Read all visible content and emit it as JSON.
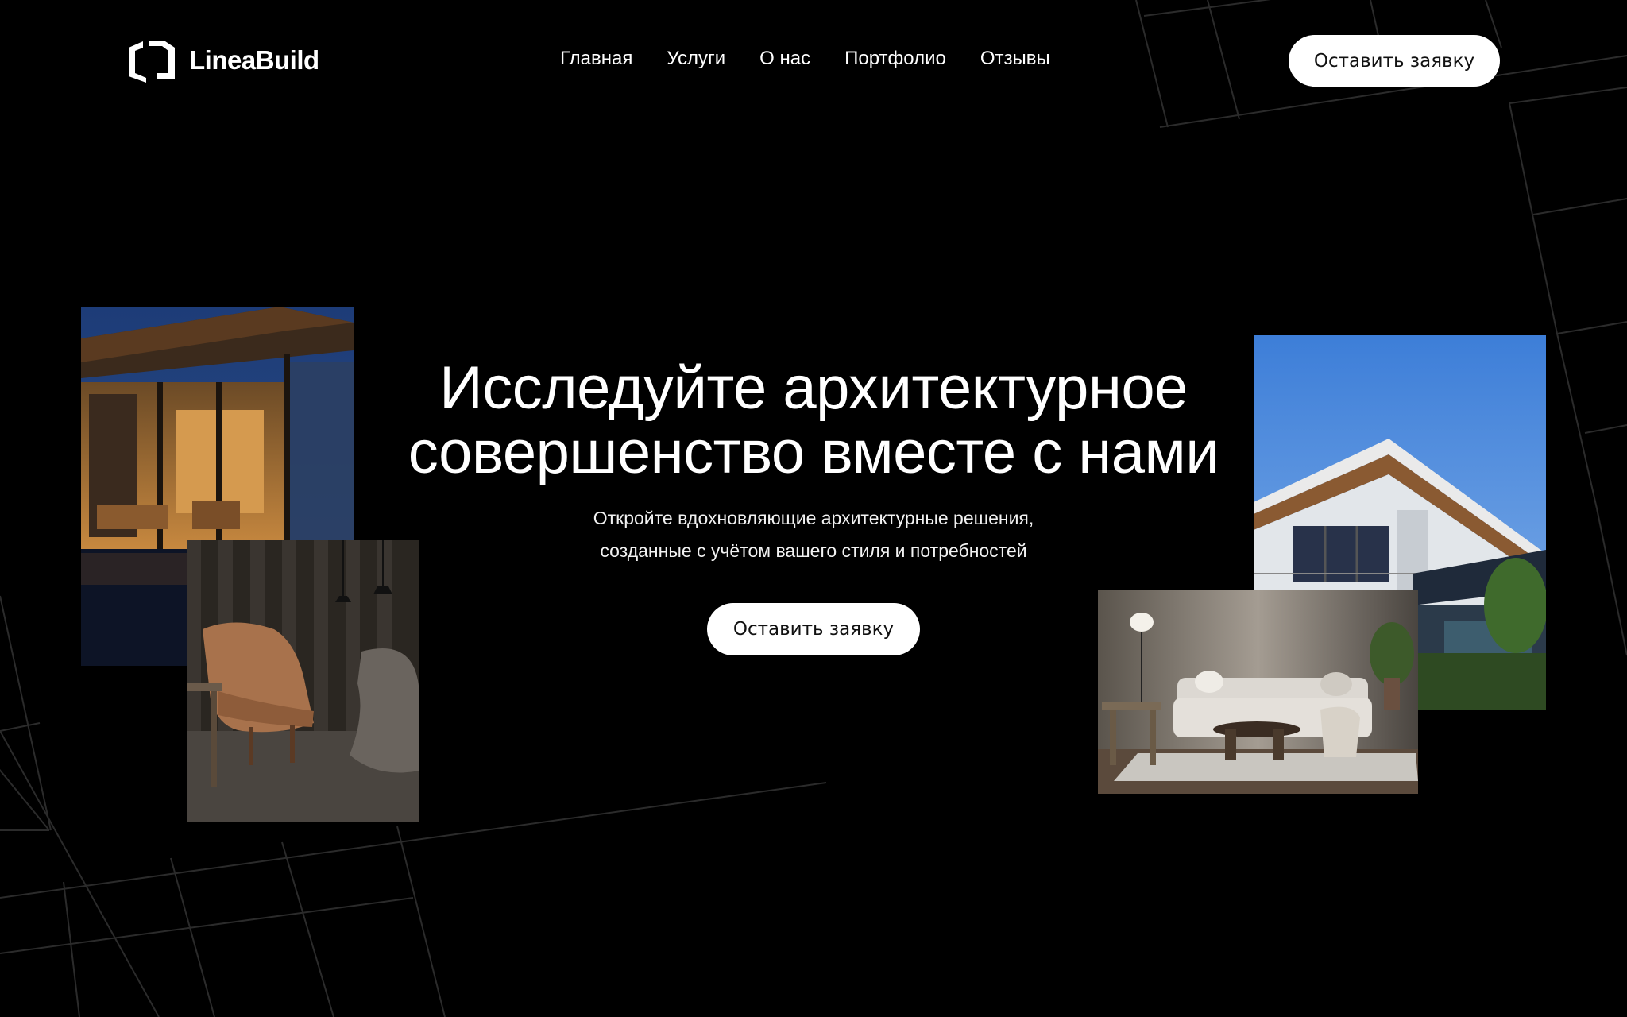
{
  "brand": {
    "name": "LineaBuild",
    "logo_icon": "linea-build-logo"
  },
  "nav": {
    "items": [
      {
        "label": "Главная"
      },
      {
        "label": "Услуги"
      },
      {
        "label": "О нас"
      },
      {
        "label": "Портфолио"
      },
      {
        "label": "Отзывы"
      }
    ]
  },
  "header": {
    "cta_label": "Оставить заявку"
  },
  "hero": {
    "title_line1": "Исследуйте архитектурное",
    "title_line2": "совершенство вместе с нами",
    "subtitle_line1": "Откройте вдохновляющие архитектурные решения,",
    "subtitle_line2": "созданные с учётом вашего стиля и потребностей",
    "cta_label": "Оставить заявку"
  },
  "images": [
    {
      "name": "terrace-night-photo"
    },
    {
      "name": "lounge-chair-photo"
    },
    {
      "name": "modern-house-photo"
    },
    {
      "name": "living-room-photo"
    }
  ],
  "colors": {
    "background": "#000000",
    "text": "#ffffff",
    "button_bg": "#ffffff",
    "button_text": "#111111",
    "grid_line": "#2a2a2a"
  }
}
